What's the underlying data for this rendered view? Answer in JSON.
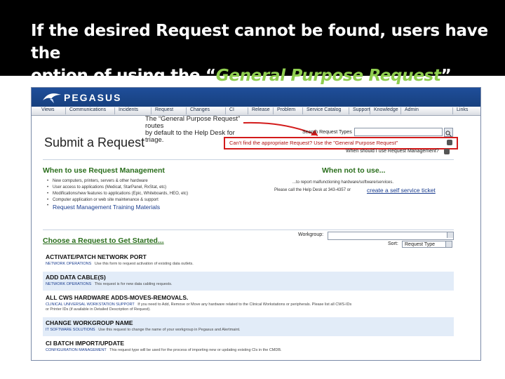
{
  "slide": {
    "line1": "If the desired Request cannot be found, users have the",
    "line2_pre": "option of using the “",
    "line2_em": "General Purpose Request",
    "line2_post": "” form.",
    "accent": "#8fce4f"
  },
  "app": {
    "name": "PEGASUS",
    "brand_color": "#1f4e9a"
  },
  "nav": [
    "Views",
    "Communications",
    "Incidents",
    "Request",
    "Changes",
    "CI",
    "Release",
    "Problem",
    "Service Catalog",
    "Support",
    "Knowledge",
    "Admin",
    "Links"
  ],
  "annotation": {
    "line1": "The “General Purpose Request” routes",
    "line2": "by default to the Help Desk for triage."
  },
  "page_title": "Submit a Request",
  "search": {
    "label": "Search Request Types",
    "value": ""
  },
  "gpr_link": "Can't find the appropriate Request? Use the \"General Purpose Request\"",
  "when_question": "When should I use Request Management?",
  "when_use": {
    "title": "When to use Request Management",
    "items": [
      "New computers, printers, servers & other hardware",
      "User access to applications (Medicat, StarPanel, RxStat, etc)",
      "Modifications/new features to applications (Epic, Whiteboards, HEO, etc)",
      "Computer application or web site maintenance & support"
    ],
    "training": "Request Management Training Materials"
  },
  "when_not": {
    "title": "When not to use...",
    "line1": "...to report malfunctioning hardware/software/services.",
    "line2": "Please call the Help Desk at 343-4357 or",
    "link": "create a self service ticket"
  },
  "choose": "Choose a Request to Get Started...",
  "workgroup": {
    "label": "Workgroup:",
    "value": ""
  },
  "sort": {
    "label": "Sort:",
    "value": "Request Type"
  },
  "requests": [
    {
      "title": "ACTIVATE/PATCH NETWORK PORT",
      "group": "NETWORK OPERATIONS",
      "desc": "Use this form to request activation of existing data outlets."
    },
    {
      "title": "ADD DATA CABLE(S)",
      "group": "NETWORK OPERATIONS",
      "desc": "This request is for new data cabling requests."
    },
    {
      "title": "ALL CWS HARDWARE ADDS-MOVES-REMOVALS.",
      "group": "CLINICAL UNIVERSAL WORKSTATION SUPPORT",
      "desc": "If you need to Add, Remove or Move any hardware related to the Clinical Workstations or peripherals. Please list all CWS-IDs"
    },
    {
      "title": "CHANGE WORKGROUP NAME",
      "group": "IT SOFTWARE SOLUTIONS",
      "desc": "Use this request to change the name of your workgroup in Pegasus and Alertmaint."
    },
    {
      "title": "CI BATCH IMPORT/UPDATE",
      "group": "CONFIGURATION MANAGEMENT",
      "desc": "This request type will be used for the process of importing new or updating existing CIs in the CMDB."
    }
  ],
  "extra_line": "or Printer IDs (if available in Detailed Description of Request)."
}
